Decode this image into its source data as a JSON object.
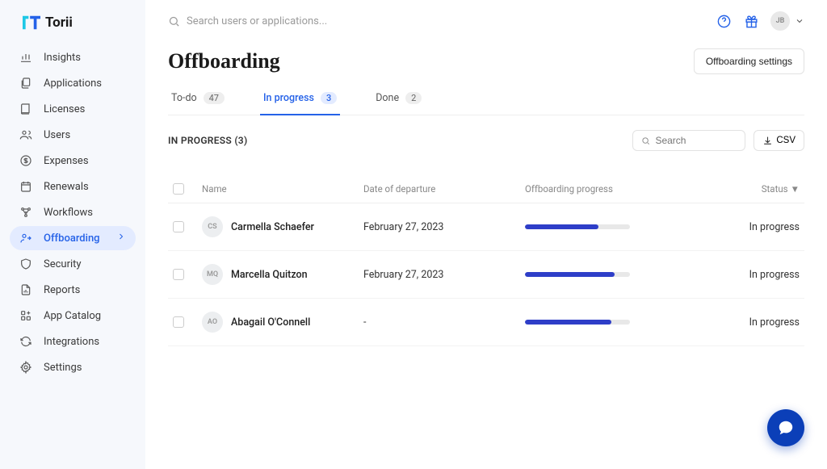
{
  "brand": {
    "name": "Torii"
  },
  "search": {
    "placeholder": "Search users or applications..."
  },
  "user": {
    "initials": "JB"
  },
  "sidebar": {
    "items": [
      {
        "label": "Insights"
      },
      {
        "label": "Applications"
      },
      {
        "label": "Licenses"
      },
      {
        "label": "Users"
      },
      {
        "label": "Expenses"
      },
      {
        "label": "Renewals"
      },
      {
        "label": "Workflows"
      },
      {
        "label": "Offboarding"
      },
      {
        "label": "Security"
      },
      {
        "label": "Reports"
      },
      {
        "label": "App Catalog"
      },
      {
        "label": "Integrations"
      },
      {
        "label": "Settings"
      }
    ]
  },
  "page": {
    "title": "Offboarding",
    "settings_button": "Offboarding settings"
  },
  "tabs": {
    "todo": {
      "label": "To-do",
      "count": "47"
    },
    "in_progress": {
      "label": "In progress",
      "count": "3"
    },
    "done": {
      "label": "Done",
      "count": "2"
    }
  },
  "section": {
    "title": "IN PROGRESS (3)",
    "search_placeholder": "Search",
    "csv_label": "CSV"
  },
  "table": {
    "columns": {
      "name": "Name",
      "date": "Date of departure",
      "progress": "Offboarding progress",
      "status": "Status"
    },
    "rows": [
      {
        "initials": "CS",
        "name": "Carmella Schaefer",
        "date": "February 27, 2023",
        "progress_pct": 70,
        "status": "In progress"
      },
      {
        "initials": "MQ",
        "name": "Marcella Quitzon",
        "date": "February 27, 2023",
        "progress_pct": 85,
        "status": "In progress"
      },
      {
        "initials": "AO",
        "name": "Abagail O'Connell",
        "date": "-",
        "progress_pct": 82,
        "status": "In progress"
      }
    ]
  }
}
